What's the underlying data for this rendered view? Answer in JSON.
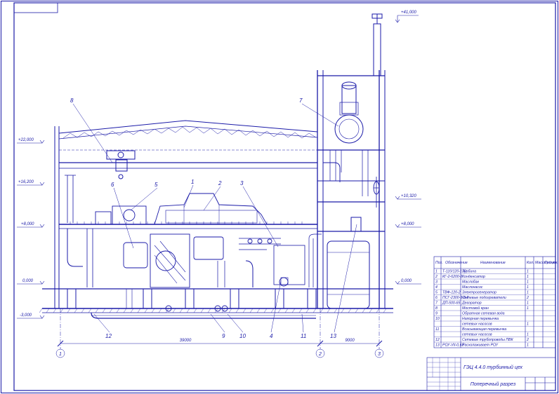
{
  "elevations": [
    {
      "id": "e41",
      "label": "+41,000"
    },
    {
      "id": "e22",
      "label": "+22,000"
    },
    {
      "id": "e16",
      "label": "+16,200"
    },
    {
      "id": "e10",
      "label": "+10,320"
    },
    {
      "id": "e8l",
      "label": "+8,000"
    },
    {
      "id": "e8r",
      "label": "+8,000"
    },
    {
      "id": "e0l",
      "label": "0,000"
    },
    {
      "id": "e0r",
      "label": "0,000"
    },
    {
      "id": "em3",
      "label": "-3,000"
    }
  ],
  "callouts": [
    "1",
    "2",
    "3",
    "4",
    "5",
    "6",
    "7",
    "8",
    "9",
    "10",
    "11",
    "12",
    "13"
  ],
  "axes": [
    "1",
    "2",
    "3"
  ],
  "dimensions": {
    "span_main": "39000",
    "span_right": "9000"
  },
  "spec_table": {
    "headers": [
      "Поз.",
      "Обозначение",
      "Наименование",
      "Кол.",
      "Масса ед.,кг",
      "Примеч."
    ],
    "rows": [
      [
        "1",
        "Т-110/120-130",
        "Турбина",
        "1"
      ],
      [
        "2",
        "КГ-2-6200-2",
        "Конденсатор",
        "1"
      ],
      [
        "3",
        "",
        "Маслобак",
        "1"
      ],
      [
        "4",
        "",
        "Маслонасос",
        "1"
      ],
      [
        "5",
        "ТВФ-120-2",
        "Электрогенератор",
        "1"
      ],
      [
        "6",
        "ПСГ-2300-3-8-2",
        "Сетевые подогреватели",
        "2"
      ],
      [
        "7",
        "ДП-500-65",
        "Деаэратор",
        "1"
      ],
      [
        "8",
        "",
        "Мостовой кран",
        "1"
      ],
      [
        "9",
        "",
        "Обратная сетевая вода",
        ""
      ],
      [
        "10",
        "",
        "Напорная перемычка",
        ""
      ],
      [
        "",
        "",
        "сетевых насосов",
        "1"
      ],
      [
        "11",
        "",
        "Всасывающая перемычка",
        ""
      ],
      [
        "",
        "",
        "сетевых насосов",
        "1"
      ],
      [
        "12",
        "",
        "Сетевые трубопроводы ПВК",
        "2"
      ],
      [
        "13",
        "РОУ-VII-0,63",
        "Расхолаживает РОУ",
        "1"
      ]
    ]
  },
  "title_block": {
    "code": "ГЭЦ 4.4.0 турбинный цех",
    "sheet_title": "Поперечный разрез"
  }
}
